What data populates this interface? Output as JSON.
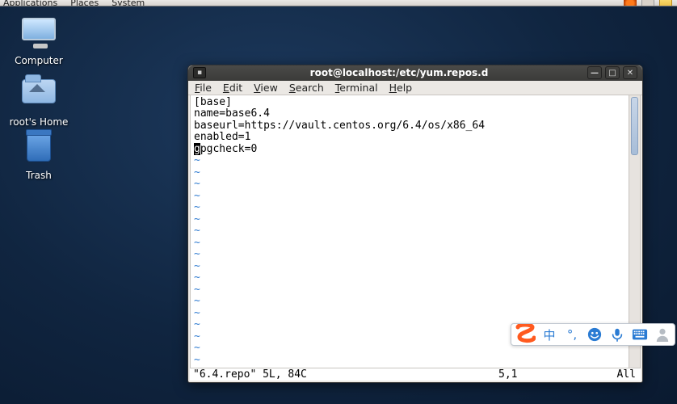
{
  "panel": {
    "menus": [
      "Applications",
      "Places",
      "System"
    ]
  },
  "desktop": {
    "computer": "Computer",
    "home": "root's Home",
    "trash": "Trash"
  },
  "window": {
    "title": "root@localhost:/etc/yum.repos.d",
    "menus": {
      "file": "File",
      "edit": "Edit",
      "view": "View",
      "search": "Search",
      "terminal": "Terminal",
      "help": "Help"
    },
    "content": {
      "l1": "[base]",
      "l2": "name=base6.4",
      "l3": "baseurl=https://vault.centos.org/6.4/os/x86_64",
      "l4": "enabled=1",
      "l5_cursor": "g",
      "l5_rest": "pgcheck=0"
    },
    "status": {
      "file": "\"6.4.repo\" 5L, 84C",
      "pos": "5,1",
      "all": "All"
    }
  },
  "ime": {
    "lang": "中",
    "punct": "，",
    "emoji": "☻",
    "mic": "🎤",
    "keyboard": "⌨",
    "user": "👤"
  }
}
